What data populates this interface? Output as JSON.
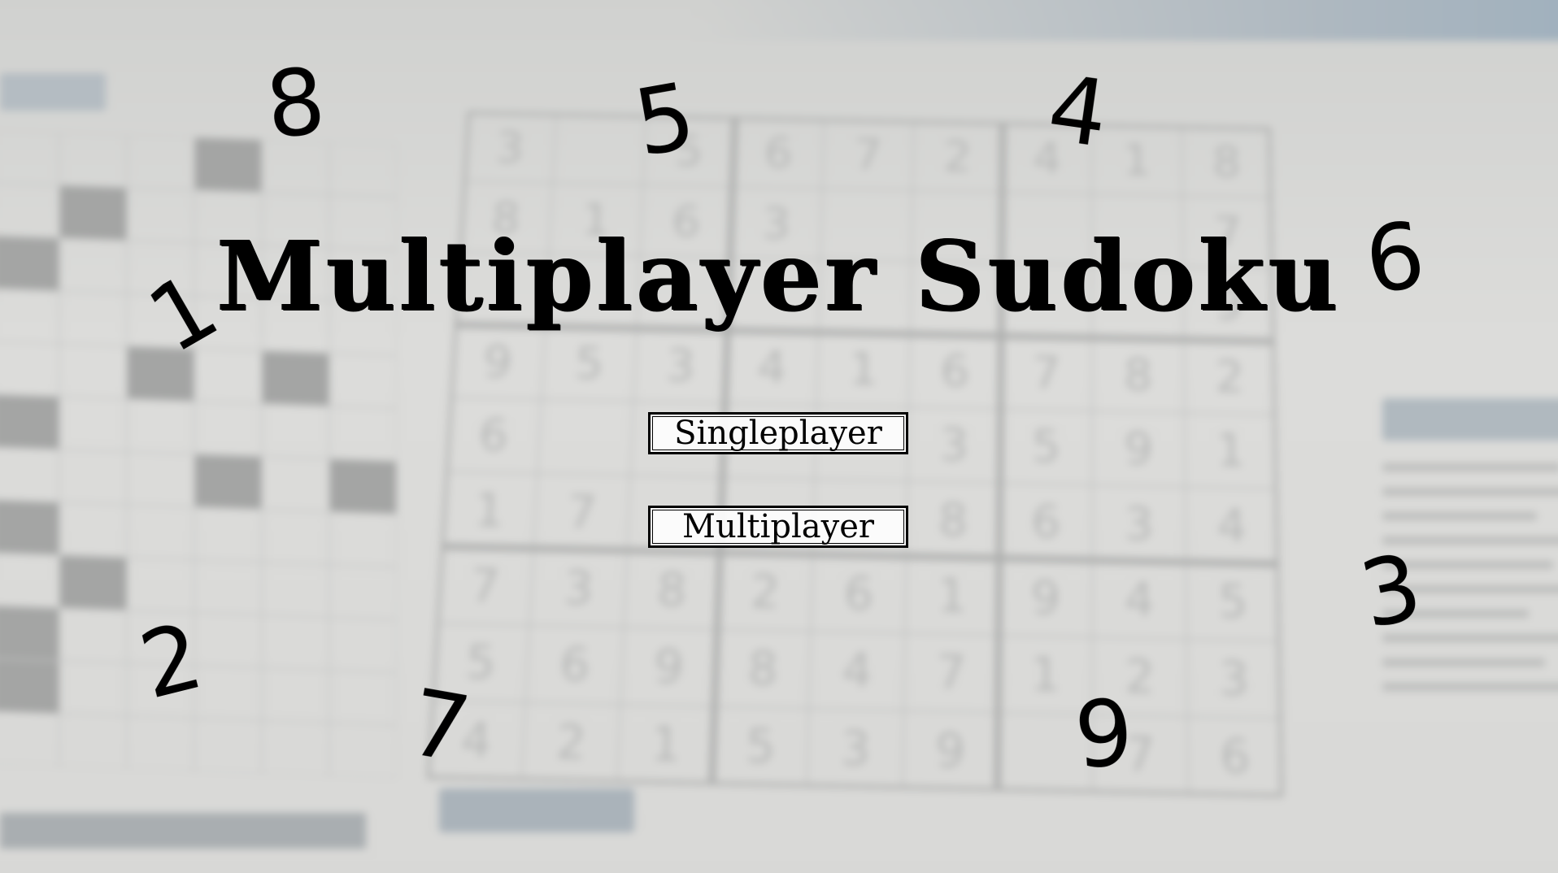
{
  "title": "Multiplayer Sudoku",
  "menu": {
    "singleplayer_label": "Singleplayer",
    "multiplayer_label": "Multiplayer"
  },
  "floating_digits": [
    "8",
    "5",
    "4",
    "6",
    "1",
    "2",
    "7",
    "9",
    "3"
  ],
  "background_sudoku": [
    [
      "3",
      "",
      "5",
      "6",
      "7",
      "2",
      "4",
      "1",
      "8"
    ],
    [
      "8",
      "1",
      "6",
      "3",
      "",
      "",
      "",
      "",
      "7"
    ],
    [
      "",
      "",
      "",
      "",
      "",
      "",
      "",
      "",
      "9"
    ],
    [
      "9",
      "5",
      "3",
      "4",
      "1",
      "6",
      "7",
      "8",
      "2"
    ],
    [
      "6",
      "",
      "",
      "",
      "",
      "3",
      "5",
      "9",
      "1"
    ],
    [
      "1",
      "7",
      "",
      "",
      "",
      "8",
      "6",
      "3",
      "4"
    ],
    [
      "7",
      "3",
      "8",
      "2",
      "6",
      "1",
      "9",
      "4",
      "5"
    ],
    [
      "5",
      "6",
      "9",
      "8",
      "4",
      "7",
      "1",
      "2",
      "3"
    ],
    [
      "4",
      "2",
      "1",
      "5",
      "3",
      "9",
      "",
      "7",
      "6"
    ]
  ]
}
